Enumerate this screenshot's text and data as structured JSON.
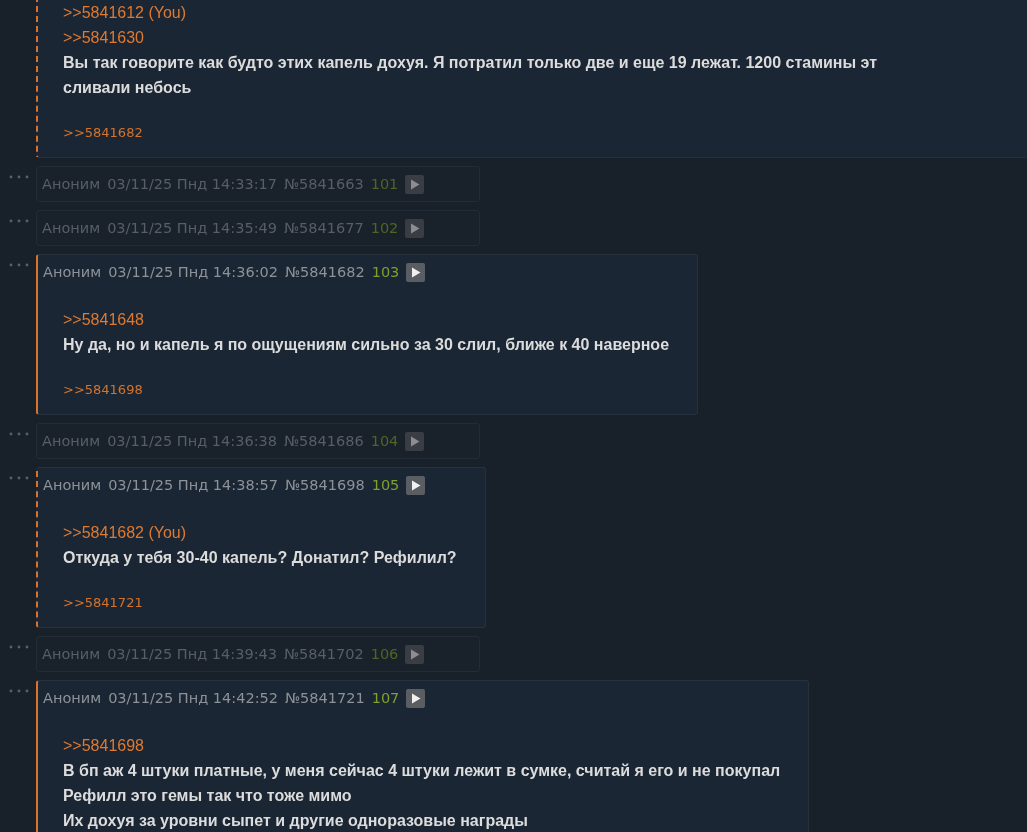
{
  "posts": [
    {
      "kind": "full",
      "replies_to_you": true,
      "quotes": [
        ">>5841612 (You)",
        ">>5841630"
      ],
      "lines": [
        "Вы так говорите как будто этих капель дохуя. Я потратил только две и еще 19 лежат. 1200 стамины эт",
        "сливали небось"
      ],
      "replies": [
        ">>5841682"
      ]
    },
    {
      "kind": "collapsed",
      "author": "Аноним",
      "date": "03/11/25 Пнд 14:33:17",
      "number": "№5841663",
      "index": "101"
    },
    {
      "kind": "collapsed",
      "author": "Аноним",
      "date": "03/11/25 Пнд 14:35:49",
      "number": "№5841677",
      "index": "102"
    },
    {
      "kind": "full",
      "replies_to_you": false,
      "author": "Аноним",
      "date": "03/11/25 Пнд 14:36:02",
      "number": "№5841682",
      "index": "103",
      "quotes": [
        ">>5841648"
      ],
      "lines": [
        "Ну да, но и капель я по ощущениям сильно за 30 слил, ближе к 40 наверное"
      ],
      "replies": [
        ">>5841698"
      ]
    },
    {
      "kind": "collapsed",
      "author": "Аноним",
      "date": "03/11/25 Пнд 14:36:38",
      "number": "№5841686",
      "index": "104"
    },
    {
      "kind": "full",
      "replies_to_you": true,
      "author": "Аноним",
      "date": "03/11/25 Пнд 14:38:57",
      "number": "№5841698",
      "index": "105",
      "quotes": [
        ">>5841682 (You)"
      ],
      "lines": [
        "Откуда у тебя 30-40 капель? Донатил? Рефилил?"
      ],
      "replies": [
        ">>5841721"
      ]
    },
    {
      "kind": "collapsed",
      "author": "Аноним",
      "date": "03/11/25 Пнд 14:39:43",
      "number": "№5841702",
      "index": "106"
    },
    {
      "kind": "full",
      "replies_to_you": false,
      "author": "Аноним",
      "date": "03/11/25 Пнд 14:42:52",
      "number": "№5841721",
      "index": "107",
      "quotes": [
        ">>5841698"
      ],
      "lines": [
        "В бп аж 4 штуки платные, у меня сейчас 4 штуки лежит в сумке, считай я его и не покупал",
        "Рефилл это гемы так что тоже мимо",
        "Их дохуя за уровни сыпет и другие одноразовые награды"
      ]
    }
  ]
}
